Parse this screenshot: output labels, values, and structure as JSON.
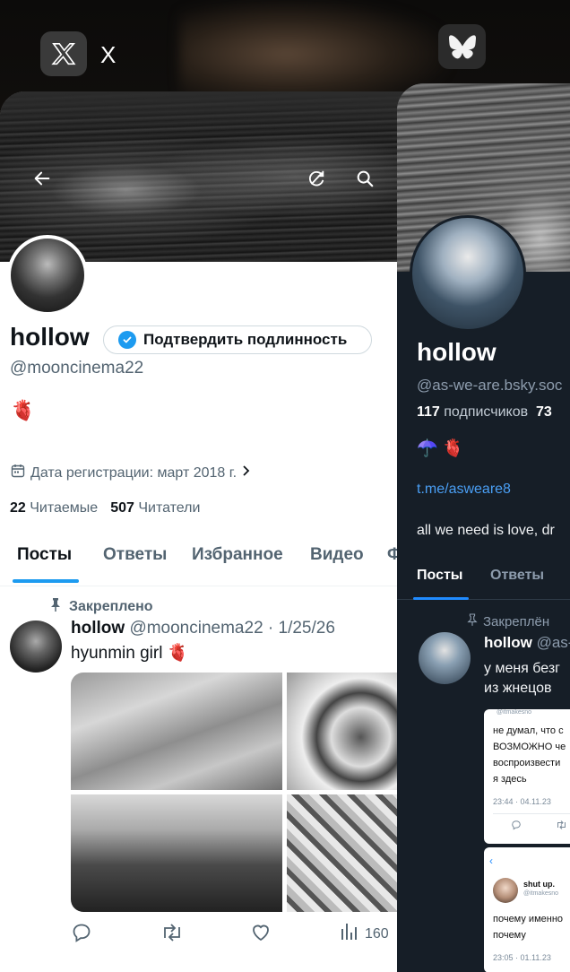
{
  "switcher": {
    "x_app_label": "X",
    "x_icon": "x-logo-icon",
    "bsky_icon": "butterfly-icon"
  },
  "x_profile": {
    "name": "hollow",
    "verify_label": "Подтвердить подлинность",
    "handle": "@mooncinema22",
    "bio_emoji": "🫀",
    "joined": "Дата регистрации: март 2018 г.",
    "following_count": "22",
    "following_label": "Читаемые",
    "followers_count": "507",
    "followers_label": "Читатели",
    "tabs": [
      "Посты",
      "Ответы",
      "Избранное",
      "Видео",
      "Ф"
    ],
    "pinned_label": "Закреплено",
    "post": {
      "author": "hollow",
      "handle_date": "@mooncinema22 · 1/25/26",
      "text": "hyunmin girl 🫀",
      "views": "160"
    },
    "accent": "#1d9bf0"
  },
  "bsky_profile": {
    "name": "hollow",
    "handle": "@as-we-are.bsky.soc",
    "followers_count": "117",
    "followers_label": "подписчиков",
    "following_count": "73",
    "emojis": "☂️ 🫀",
    "link": "t.me/asweare8",
    "bio": "all we need is love, dr",
    "tabs": [
      "Посты",
      "Ответы"
    ],
    "pinned_label": "Закреплён",
    "post": {
      "author": "hollow",
      "handle": "@as-",
      "text_line1": "у меня безг",
      "text_line2": "из жнецов"
    },
    "shot1": {
      "handle": "@itmakesno",
      "lines": [
        "не думал, что с",
        "ВОЗМОЖНО че",
        "воспроизвести",
        "я здесь"
      ],
      "time": "23:44 · 04.11.23"
    },
    "shot2": {
      "name": "shut up.",
      "handle": "@itmakesno",
      "lines": [
        "почему именно",
        "почему"
      ],
      "time": "23:05 · 01.11.23"
    },
    "accent": "#208bfe"
  }
}
